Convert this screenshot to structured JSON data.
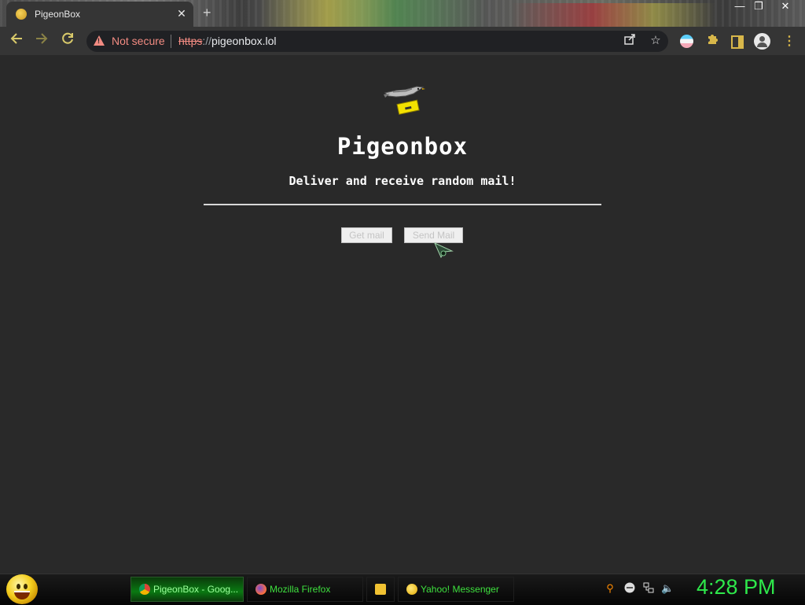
{
  "browser": {
    "tab": {
      "title": "PigeonBox",
      "close_glyph": "✕",
      "favicon": "pigeonbox-favicon"
    },
    "new_tab_glyph": "+",
    "window_controls": {
      "minimize": "—",
      "restore": "❐",
      "close": "✕"
    },
    "security_label": "Not secure",
    "url": {
      "scheme": "https",
      "separator": "://",
      "host": "pigeonbox.lol"
    },
    "icons": [
      "back-icon",
      "forward-icon",
      "reload-icon",
      "warning-icon",
      "share-icon",
      "star-icon",
      "extension-flag-icon",
      "puzzle-icon",
      "side-panel-icon",
      "profile-icon",
      "menu-icon"
    ],
    "colors": {
      "warning": "#f28b82",
      "toolbar": "#353535",
      "icon_accent": "#d8c96a"
    }
  },
  "page": {
    "heading": "Pigeonbox",
    "tagline": "Deliver and receive random mail!",
    "get_mail_label": "Get mail",
    "send_mail_label": "Send Mail",
    "background": "#292929"
  },
  "taskbar": {
    "items": [
      {
        "label": "PigeonBox - Goog...",
        "icon": "chrome-icon",
        "active": true
      },
      {
        "label": "Mozilla Firefox",
        "icon": "firefox-icon",
        "active": false
      },
      {
        "label": "",
        "icon": "folder-icon",
        "active": false
      },
      {
        "label": "Yahoo! Messenger",
        "icon": "yahoo-messenger-icon",
        "active": false
      }
    ],
    "tray_icons": [
      "search-icon",
      "messenger-status-icon",
      "network-icon",
      "volume-icon"
    ],
    "clock": "4:28 PM",
    "clock_color": "#2ee84b"
  }
}
